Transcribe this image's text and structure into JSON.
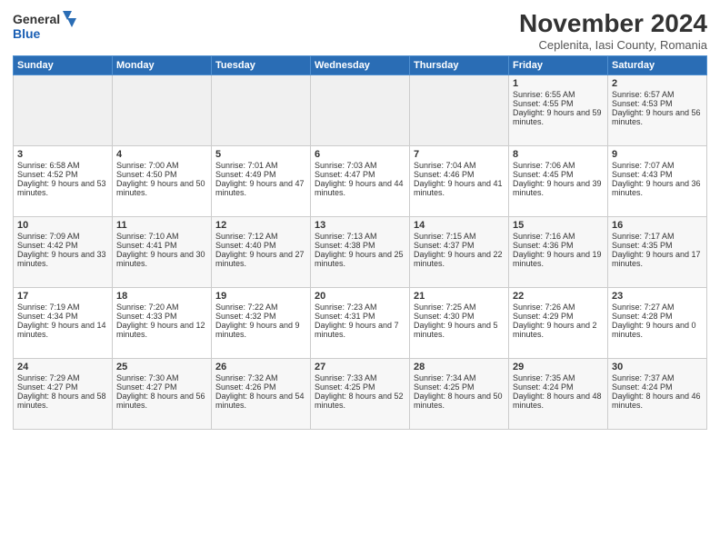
{
  "logo": {
    "line1": "General",
    "line2": "Blue"
  },
  "title": "November 2024",
  "subtitle": "Ceplenita, Iasi County, Romania",
  "days_header": [
    "Sunday",
    "Monday",
    "Tuesday",
    "Wednesday",
    "Thursday",
    "Friday",
    "Saturday"
  ],
  "weeks": [
    [
      {
        "day": "",
        "info": ""
      },
      {
        "day": "",
        "info": ""
      },
      {
        "day": "",
        "info": ""
      },
      {
        "day": "",
        "info": ""
      },
      {
        "day": "",
        "info": ""
      },
      {
        "day": "1",
        "info": "Sunrise: 6:55 AM\nSunset: 4:55 PM\nDaylight: 9 hours and 59 minutes."
      },
      {
        "day": "2",
        "info": "Sunrise: 6:57 AM\nSunset: 4:53 PM\nDaylight: 9 hours and 56 minutes."
      }
    ],
    [
      {
        "day": "3",
        "info": "Sunrise: 6:58 AM\nSunset: 4:52 PM\nDaylight: 9 hours and 53 minutes."
      },
      {
        "day": "4",
        "info": "Sunrise: 7:00 AM\nSunset: 4:50 PM\nDaylight: 9 hours and 50 minutes."
      },
      {
        "day": "5",
        "info": "Sunrise: 7:01 AM\nSunset: 4:49 PM\nDaylight: 9 hours and 47 minutes."
      },
      {
        "day": "6",
        "info": "Sunrise: 7:03 AM\nSunset: 4:47 PM\nDaylight: 9 hours and 44 minutes."
      },
      {
        "day": "7",
        "info": "Sunrise: 7:04 AM\nSunset: 4:46 PM\nDaylight: 9 hours and 41 minutes."
      },
      {
        "day": "8",
        "info": "Sunrise: 7:06 AM\nSunset: 4:45 PM\nDaylight: 9 hours and 39 minutes."
      },
      {
        "day": "9",
        "info": "Sunrise: 7:07 AM\nSunset: 4:43 PM\nDaylight: 9 hours and 36 minutes."
      }
    ],
    [
      {
        "day": "10",
        "info": "Sunrise: 7:09 AM\nSunset: 4:42 PM\nDaylight: 9 hours and 33 minutes."
      },
      {
        "day": "11",
        "info": "Sunrise: 7:10 AM\nSunset: 4:41 PM\nDaylight: 9 hours and 30 minutes."
      },
      {
        "day": "12",
        "info": "Sunrise: 7:12 AM\nSunset: 4:40 PM\nDaylight: 9 hours and 27 minutes."
      },
      {
        "day": "13",
        "info": "Sunrise: 7:13 AM\nSunset: 4:38 PM\nDaylight: 9 hours and 25 minutes."
      },
      {
        "day": "14",
        "info": "Sunrise: 7:15 AM\nSunset: 4:37 PM\nDaylight: 9 hours and 22 minutes."
      },
      {
        "day": "15",
        "info": "Sunrise: 7:16 AM\nSunset: 4:36 PM\nDaylight: 9 hours and 19 minutes."
      },
      {
        "day": "16",
        "info": "Sunrise: 7:17 AM\nSunset: 4:35 PM\nDaylight: 9 hours and 17 minutes."
      }
    ],
    [
      {
        "day": "17",
        "info": "Sunrise: 7:19 AM\nSunset: 4:34 PM\nDaylight: 9 hours and 14 minutes."
      },
      {
        "day": "18",
        "info": "Sunrise: 7:20 AM\nSunset: 4:33 PM\nDaylight: 9 hours and 12 minutes."
      },
      {
        "day": "19",
        "info": "Sunrise: 7:22 AM\nSunset: 4:32 PM\nDaylight: 9 hours and 9 minutes."
      },
      {
        "day": "20",
        "info": "Sunrise: 7:23 AM\nSunset: 4:31 PM\nDaylight: 9 hours and 7 minutes."
      },
      {
        "day": "21",
        "info": "Sunrise: 7:25 AM\nSunset: 4:30 PM\nDaylight: 9 hours and 5 minutes."
      },
      {
        "day": "22",
        "info": "Sunrise: 7:26 AM\nSunset: 4:29 PM\nDaylight: 9 hours and 2 minutes."
      },
      {
        "day": "23",
        "info": "Sunrise: 7:27 AM\nSunset: 4:28 PM\nDaylight: 9 hours and 0 minutes."
      }
    ],
    [
      {
        "day": "24",
        "info": "Sunrise: 7:29 AM\nSunset: 4:27 PM\nDaylight: 8 hours and 58 minutes."
      },
      {
        "day": "25",
        "info": "Sunrise: 7:30 AM\nSunset: 4:27 PM\nDaylight: 8 hours and 56 minutes."
      },
      {
        "day": "26",
        "info": "Sunrise: 7:32 AM\nSunset: 4:26 PM\nDaylight: 8 hours and 54 minutes."
      },
      {
        "day": "27",
        "info": "Sunrise: 7:33 AM\nSunset: 4:25 PM\nDaylight: 8 hours and 52 minutes."
      },
      {
        "day": "28",
        "info": "Sunrise: 7:34 AM\nSunset: 4:25 PM\nDaylight: 8 hours and 50 minutes."
      },
      {
        "day": "29",
        "info": "Sunrise: 7:35 AM\nSunset: 4:24 PM\nDaylight: 8 hours and 48 minutes."
      },
      {
        "day": "30",
        "info": "Sunrise: 7:37 AM\nSunset: 4:24 PM\nDaylight: 8 hours and 46 minutes."
      }
    ]
  ]
}
